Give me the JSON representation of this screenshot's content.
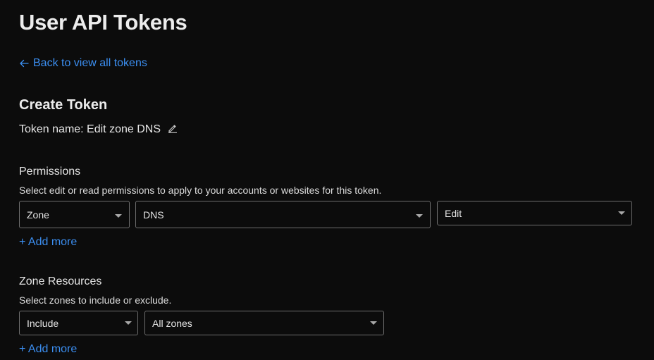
{
  "page": {
    "title": "User API Tokens"
  },
  "back_link": {
    "arrow": "←",
    "label": "Back to view all tokens",
    "icon": "arrow-left-icon"
  },
  "create": {
    "title": "Create Token",
    "token_name": "Token name: Edit zone DNS",
    "edit_icon": "pencil-icon"
  },
  "permissions": {
    "label": "Permissions",
    "help": "Select edit or read permissions to apply to your accounts or websites for this token.",
    "scope_select": "Zone",
    "resource_select": "DNS",
    "access_select": "Edit",
    "add_more": "+ Add more"
  },
  "zone_resources": {
    "label": "Zone Resources",
    "help": "Select zones to include or exclude.",
    "mode_select": "Include",
    "zones_select": "All zones",
    "add_more": "+ Add more"
  },
  "colors": {
    "background": "#0c0c0c",
    "accent": "#3b8ef0",
    "text": "#e6e6e6",
    "border": "#6e6e6e"
  }
}
